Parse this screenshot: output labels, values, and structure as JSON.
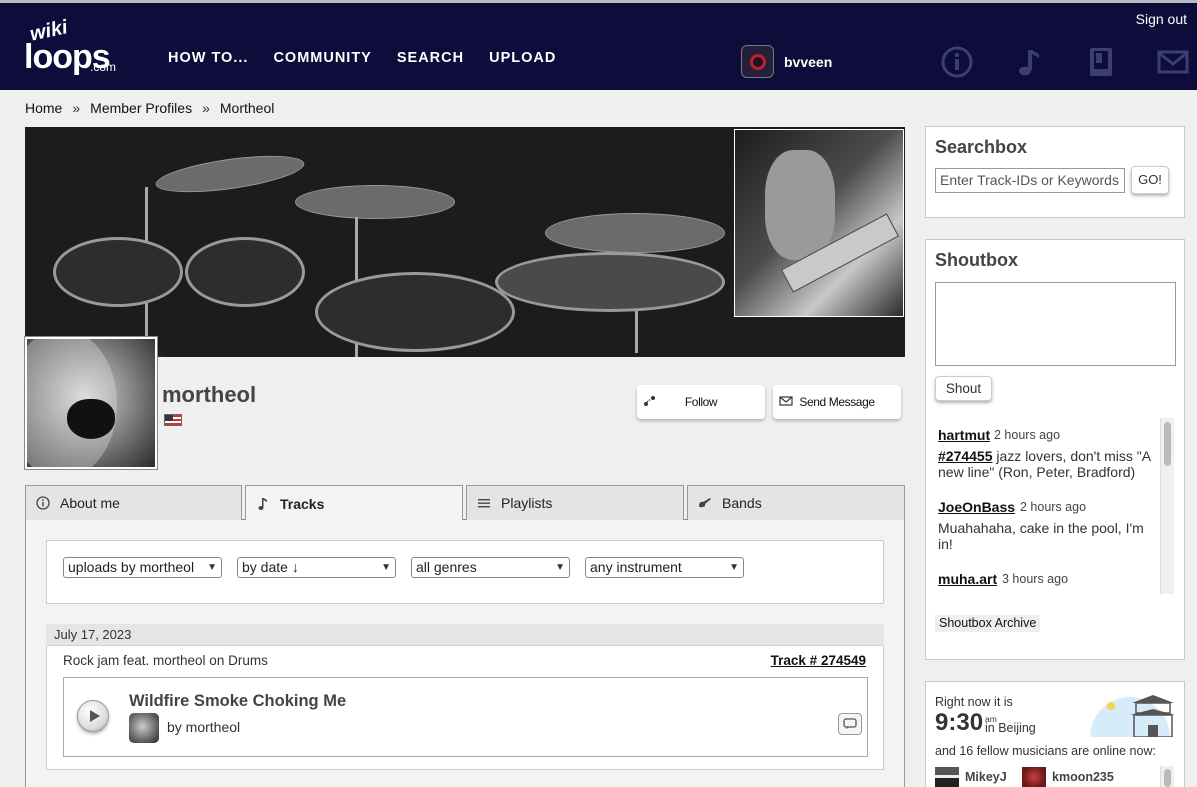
{
  "header": {
    "logo": {
      "line1": "wiki",
      "line2": "loops",
      "line3": ".com"
    },
    "nav": [
      "HOW TO...",
      "COMMUNITY",
      "SEARCH",
      "UPLOAD"
    ],
    "user_name": "bvveen",
    "sign_out": "Sign out",
    "icons": [
      "info-icon",
      "music-note-icon",
      "book-icon",
      "mail-icon"
    ]
  },
  "breadcrumb": {
    "items": [
      "Home",
      "Member Profiles",
      "Mortheol"
    ],
    "separator": "»"
  },
  "profile": {
    "name": "mortheol",
    "follow_label": "Follow",
    "message_label": "Send Message"
  },
  "tabs": [
    {
      "label": "About me",
      "icon": "info-icon"
    },
    {
      "label": "Tracks",
      "icon": "music-note-icon",
      "active": true
    },
    {
      "label": "Playlists",
      "icon": "list-icon"
    },
    {
      "label": "Bands",
      "icon": "guitar-icon"
    }
  ],
  "filters": {
    "uploads": "uploads by mortheol",
    "sort": "by date ↓",
    "genre": "all genres",
    "instrument": "any instrument"
  },
  "tracks": [
    {
      "date": "July 17, 2023",
      "description": "Rock jam feat. mortheol on Drums",
      "track_id": "Track # 274549",
      "title": "Wildfire Smoke Choking Me",
      "by": "by mortheol"
    }
  ],
  "sidebar": {
    "searchbox": {
      "title": "Searchbox",
      "placeholder": "Enter Track-IDs or Keywords",
      "go": "GO!"
    },
    "shoutbox": {
      "title": "Shoutbox",
      "button": "Shout",
      "archive": "Shoutbox Archive",
      "entries": [
        {
          "user": "hartmut",
          "time": "2 hours ago",
          "link": "#274455",
          "message": " jazz lovers, don't miss \"A new line\" (Ron, Peter, Bradford)"
        },
        {
          "user": "JoeOnBass",
          "time": "2 hours ago",
          "message": "Muahahaha, cake in the pool, I'm in!"
        },
        {
          "user": "muha.art",
          "time": "3 hours ago"
        }
      ]
    },
    "now": {
      "label": "Right now it is",
      "time": "9:30",
      "ampm": "am",
      "city": "in Beijing",
      "online_text": "and 16 fellow musicians are online now:",
      "online_users": [
        "MikeyJ",
        "kmoon235"
      ]
    }
  },
  "colors": {
    "header_bg": "#0d0c3b",
    "page_bg": "#efefef",
    "text": "#333333"
  }
}
